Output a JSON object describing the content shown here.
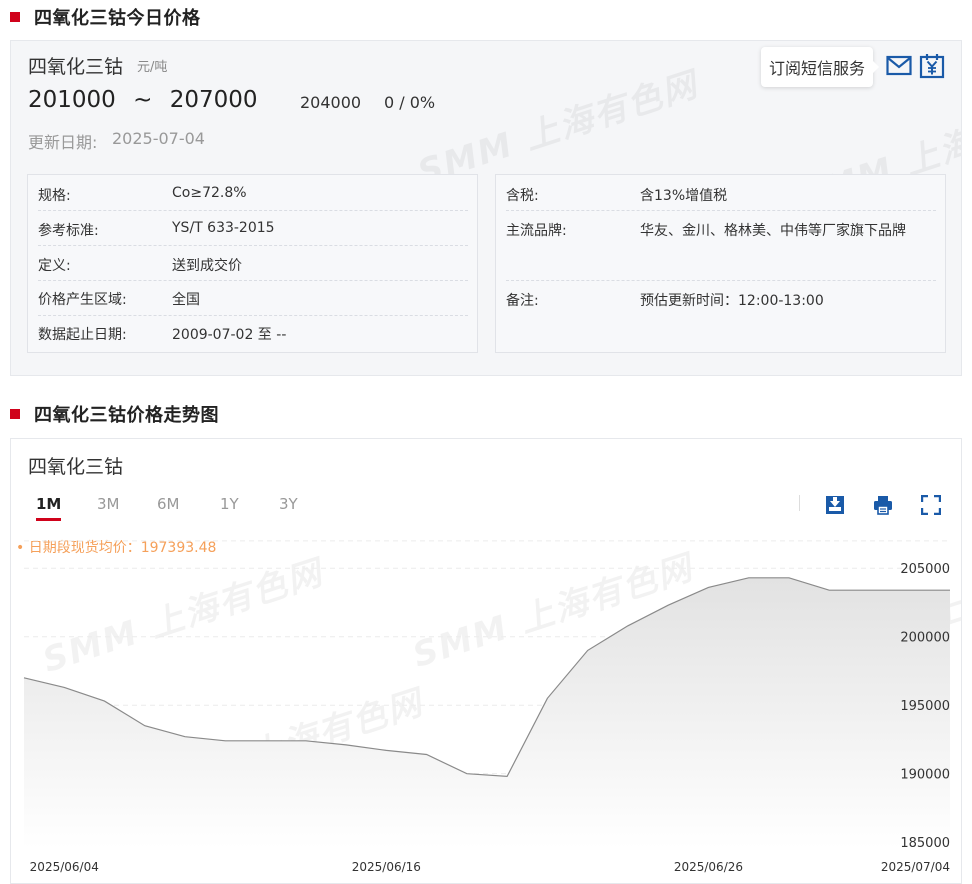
{
  "section1": {
    "title": "四氧化三钴今日价格"
  },
  "product": {
    "name": "四氧化三钴",
    "unit": "元/吨",
    "price_low": "201000",
    "tilde": "~",
    "price_high": "207000",
    "avg": "204000",
    "change": "0 / 0%",
    "update_label": "更新日期:",
    "update_date": "2025-07-04"
  },
  "subscribe": {
    "label": "订阅短信服务",
    "mail_icon": "mail-icon",
    "yen_icon": "yen-calendar-icon",
    "accent": "#1a5aa8"
  },
  "left_info": [
    {
      "key": "规格:",
      "value": "Co≥72.8%"
    },
    {
      "key": "参考标准:",
      "value": "YS/T 633-2015"
    },
    {
      "key": "定义:",
      "value": "送到成交价"
    },
    {
      "key": "价格产生区域:",
      "value": "全国"
    },
    {
      "key": "数据起止日期:",
      "value": "2009-07-02 至 --"
    }
  ],
  "right_info": [
    {
      "key": "含税:",
      "value": "含13%增值税"
    },
    {
      "key": "主流品牌:",
      "value": "华友、金川、格林美、中伟等厂家旗下品牌"
    },
    {
      "key": "备注:",
      "value": "预估更新时间：12:00-13:00"
    }
  ],
  "watermark": {
    "text": "SMM 上海有色网"
  },
  "section2": {
    "title": "四氧化三钴价格走势图"
  },
  "chart_panel": {
    "title": "四氧化三钴",
    "tabs": [
      "1M",
      "3M",
      "6M",
      "1Y",
      "3Y"
    ],
    "active_tab": "1M",
    "tools": [
      "download-icon",
      "print-icon",
      "fullscreen-icon"
    ],
    "avg_label": "• 日期段现货均价：197393.48"
  },
  "colors": {
    "brand_red": "#d0021b",
    "line": "#8a8a8a",
    "avg_label": "#f5a05a",
    "accent_blue": "#1a5aa8"
  },
  "chart_data": {
    "type": "area",
    "x": [
      "2025/06/03",
      "2025/06/04",
      "2025/06/05",
      "2025/06/06",
      "2025/06/09",
      "2025/06/10",
      "2025/06/11",
      "2025/06/12",
      "2025/06/13",
      "2025/06/16",
      "2025/06/17",
      "2025/06/18",
      "2025/06/19",
      "2025/06/20",
      "2025/06/23",
      "2025/06/24",
      "2025/06/25",
      "2025/06/26",
      "2025/06/27",
      "2025/06/30",
      "2025/07/01",
      "2025/07/02",
      "2025/07/03",
      "2025/07/04"
    ],
    "series": [
      {
        "values": [
          197000,
          196300,
          195300,
          193500,
          192700,
          192400,
          192400,
          192400,
          192100,
          191700,
          191400,
          190000,
          189800,
          195500,
          199000,
          200800,
          202300,
          203600,
          204300,
          204300,
          203400,
          203400,
          203400,
          203400
        ]
      }
    ],
    "x_tick_labels": [
      "2025/06/04",
      "2025/06/16",
      "2025/06/26",
      "2025/07/04"
    ],
    "y_tick_labels": [
      "205000",
      "200000",
      "195000",
      "190000",
      "185000"
    ],
    "ylim": [
      184500,
      207500
    ],
    "grid": true,
    "legend": "none"
  }
}
